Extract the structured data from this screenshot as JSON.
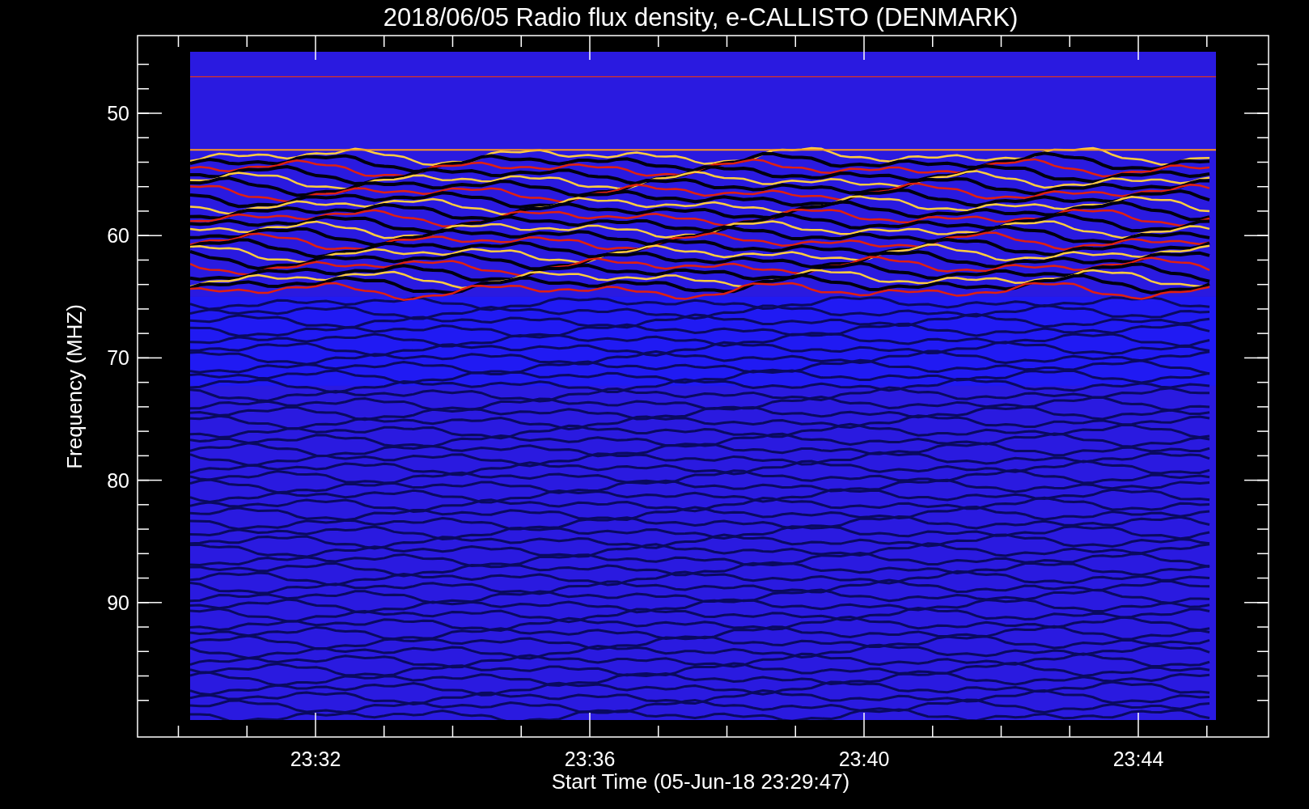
{
  "title": "2018/06/05  Radio flux density, e-CALLISTO (DENMARK)",
  "x_axis": {
    "label": "Start Time (05-Jun-18 23:29:47)",
    "ticks": [
      "23:32",
      "23:36",
      "23:40",
      "23:44"
    ]
  },
  "y_axis": {
    "label": "Frequency (MHZ)",
    "ticks": [
      "50",
      "60",
      "70",
      "80",
      "90"
    ]
  }
}
